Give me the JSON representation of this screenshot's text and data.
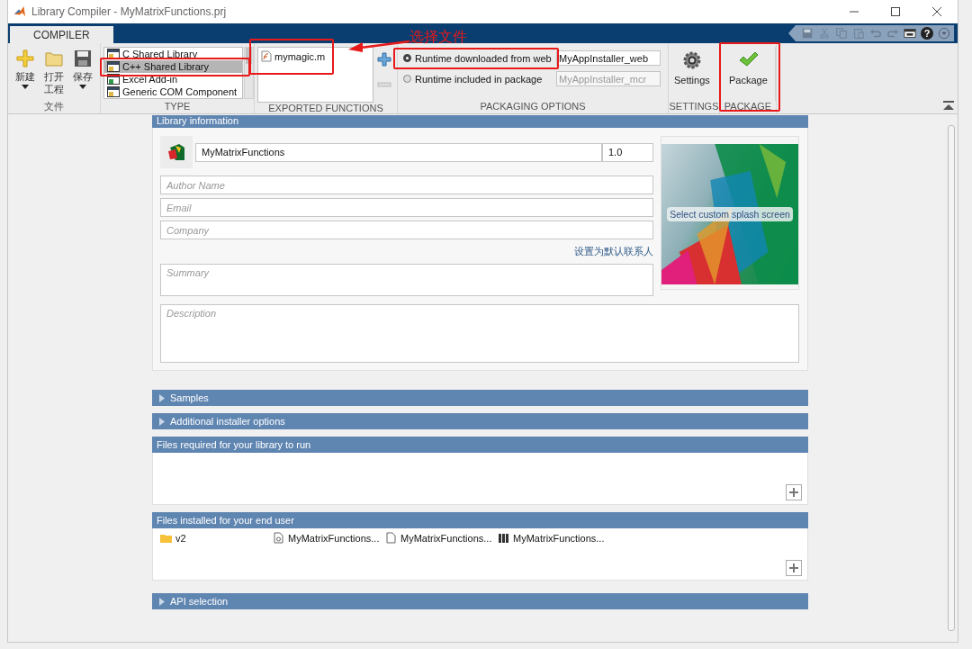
{
  "window": {
    "title": "Library Compiler - MyMatrixFunctions.prj"
  },
  "ribbon_tabs": [
    {
      "label": "COMPILER",
      "selected": true
    }
  ],
  "quick_access": [
    {
      "kind": "save"
    },
    {
      "kind": "cut"
    },
    {
      "kind": "copy"
    },
    {
      "kind": "paste"
    },
    {
      "kind": "undo"
    },
    {
      "kind": "redo"
    },
    {
      "kind": "window"
    },
    {
      "kind": "help",
      "glyph": "?"
    },
    {
      "kind": "dropdown"
    }
  ],
  "file_group": {
    "label": "文件",
    "buttons": [
      {
        "kind": "new",
        "label": "新建",
        "dropdown": true
      },
      {
        "kind": "open",
        "label": "打开工程",
        "dropdown": false
      },
      {
        "kind": "save",
        "label": "保存",
        "dropdown": true
      }
    ]
  },
  "type_group": {
    "label": "TYPE",
    "items": [
      {
        "label": "C Shared Library",
        "selected": false,
        "highlighted": false
      },
      {
        "label": "C++ Shared Library",
        "selected": true,
        "highlighted": true
      },
      {
        "label": "Excel Add-in",
        "selected": false,
        "highlighted": false
      },
      {
        "label": "Generic COM Component",
        "selected": false,
        "highlighted": false
      }
    ]
  },
  "exported_functions": {
    "label": "EXPORTED FUNCTIONS",
    "files": [
      {
        "name": "mymagic.m",
        "highlighted": true
      }
    ],
    "callout": "选择文件"
  },
  "packaging_options": {
    "label": "PACKAGING OPTIONS",
    "options": [
      {
        "label": "Runtime downloaded from web",
        "selected": true,
        "value": "MyAppInstaller_web",
        "highlighted": true
      },
      {
        "label": "Runtime included in package",
        "selected": false,
        "value": "MyAppInstaller_mcr",
        "highlighted": false
      }
    ]
  },
  "settings": {
    "label": "SETTINGS",
    "button": "Settings"
  },
  "package": {
    "label": "PACKAGE",
    "button": "Package",
    "highlighted": true
  },
  "library_information": {
    "title": "Library information",
    "name": "MyMatrixFunctions",
    "version": "1.0",
    "fields": [
      {
        "placeholder": "Author Name"
      },
      {
        "placeholder": "Email"
      },
      {
        "placeholder": "Company"
      }
    ],
    "link": "设置为默认联系人",
    "summary_placeholder": "Summary",
    "splash_label": "Select custom splash screen",
    "description_placeholder": "Description"
  },
  "sections": [
    {
      "kind": "collapsible",
      "title": "Samples",
      "expanded": false
    },
    {
      "kind": "collapsible",
      "title": "Additional installer options",
      "expanded": false
    },
    {
      "kind": "files",
      "title": "Files required for your library to run"
    },
    {
      "kind": "files",
      "title": "Files installed for your end user",
      "files": [
        {
          "kind": "folder",
          "name": "v2"
        },
        {
          "kind": "script",
          "name": "MyMatrixFunctions..."
        },
        {
          "kind": "document",
          "name": "MyMatrixFunctions..."
        },
        {
          "kind": "library",
          "name": "MyMatrixFunctions..."
        }
      ]
    },
    {
      "kind": "collapsible",
      "title": "API selection",
      "expanded": false
    }
  ]
}
